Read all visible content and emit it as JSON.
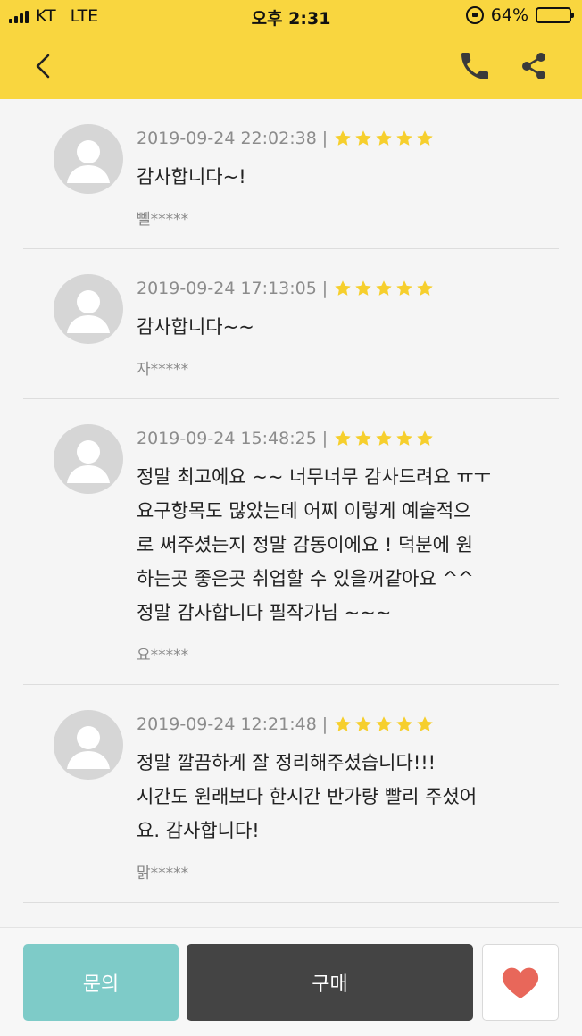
{
  "status_bar": {
    "carrier": "KT",
    "network": "LTE",
    "time": "오후 2:31",
    "battery": "64%",
    "battery_level": 0.64
  },
  "app_bar": {
    "back_icon": "chevron-left-icon",
    "call_icon": "phone-icon",
    "share_icon": "share-icon"
  },
  "reviews": [
    {
      "datetime": "2019-09-24 22:02:38",
      "separator": "|",
      "rating": 5,
      "text": "감사합니다~!",
      "author": "뻴*****"
    },
    {
      "datetime": "2019-09-24 17:13:05",
      "separator": "|",
      "rating": 5,
      "text": "감사합니다~~",
      "author": "자*****"
    },
    {
      "datetime": "2019-09-24 15:48:25",
      "separator": "|",
      "rating": 5,
      "text": "정말 최고에요 ~~ 너무너무 감사드려요 ㅠㅜ\n요구항목도 많았는데 어찌 이렇게 예술적으\n로 써주셨는지 정말 감동이에요 ! 덕분에 원\n하는곳 좋은곳 취업할 수 있을꺼같아요 ^^\n정말 감사합니다 필작가님 ~~~",
      "author": "요*****"
    },
    {
      "datetime": "2019-09-24 12:21:48",
      "separator": "|",
      "rating": 5,
      "text": "정말 깔끔하게 잘 정리해주셨습니다!!!\n시간도 원래보다 한시간 반가량 빨리 주셨어\n요. 감사합니다!",
      "author": "맑*****"
    }
  ],
  "bottom_bar": {
    "inquiry_label": "문의",
    "buy_label": "구매",
    "like_icon": "heart-icon"
  },
  "colors": {
    "header_yellow": "#f9d63f",
    "star_yellow": "#f6cf2d",
    "inquiry_teal": "#7ecbc8",
    "buy_dark": "#444444",
    "heart_red": "#e8675a"
  }
}
